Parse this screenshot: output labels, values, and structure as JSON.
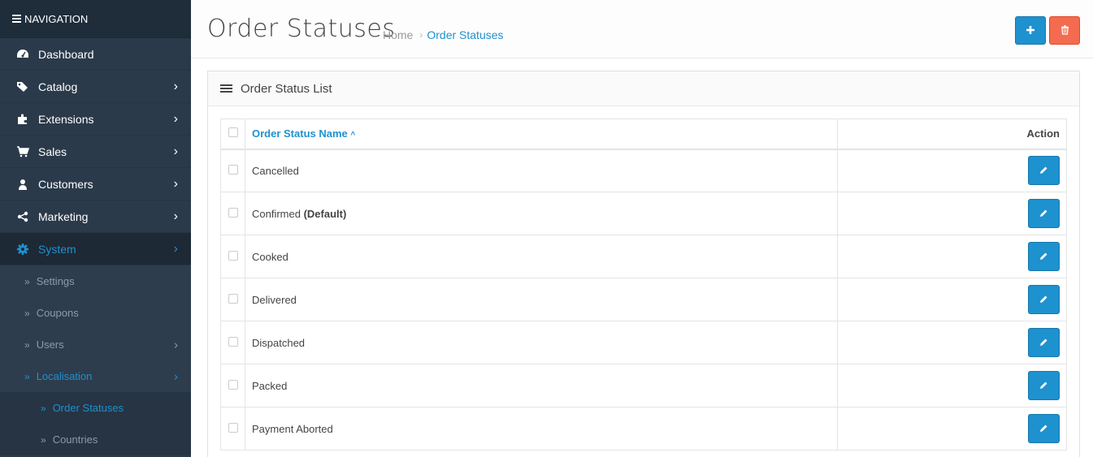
{
  "sidebar": {
    "heading": "NAVIGATION",
    "items": [
      {
        "label": "Dashboard",
        "icon": "dashboard-icon",
        "has_children": false
      },
      {
        "label": "Catalog",
        "icon": "tags-icon",
        "has_children": true
      },
      {
        "label": "Extensions",
        "icon": "puzzle-icon",
        "has_children": true
      },
      {
        "label": "Sales",
        "icon": "cart-icon",
        "has_children": true
      },
      {
        "label": "Customers",
        "icon": "user-icon",
        "has_children": true
      },
      {
        "label": "Marketing",
        "icon": "share-icon",
        "has_children": true
      },
      {
        "label": "System",
        "icon": "gear-icon",
        "has_children": true,
        "active": true
      }
    ],
    "system_sub": [
      {
        "label": "Settings"
      },
      {
        "label": "Coupons"
      },
      {
        "label": "Users"
      },
      {
        "label": "Localisation"
      }
    ],
    "localisation_sub": [
      {
        "label": "Order Statuses",
        "active": true
      },
      {
        "label": "Countries"
      }
    ]
  },
  "header": {
    "title": "Order Statuses",
    "breadcrumb": {
      "home": "Home",
      "current": "Order Statuses"
    },
    "add_icon": "plus-icon",
    "delete_icon": "trash-icon"
  },
  "panel": {
    "title": "Order Status List",
    "columns": {
      "name": "Order Status Name",
      "action": "Action"
    },
    "rows": [
      {
        "name": "Cancelled",
        "suffix": ""
      },
      {
        "name": "Confirmed",
        "suffix": "(Default)"
      },
      {
        "name": "Cooked",
        "suffix": ""
      },
      {
        "name": "Delivered",
        "suffix": ""
      },
      {
        "name": "Dispatched",
        "suffix": ""
      },
      {
        "name": "Packed",
        "suffix": ""
      },
      {
        "name": "Payment Aborted",
        "suffix": ""
      }
    ]
  },
  "colors": {
    "accent": "#1e91cf",
    "danger": "#f56b4f",
    "sidebar": "#2b3a4a"
  }
}
